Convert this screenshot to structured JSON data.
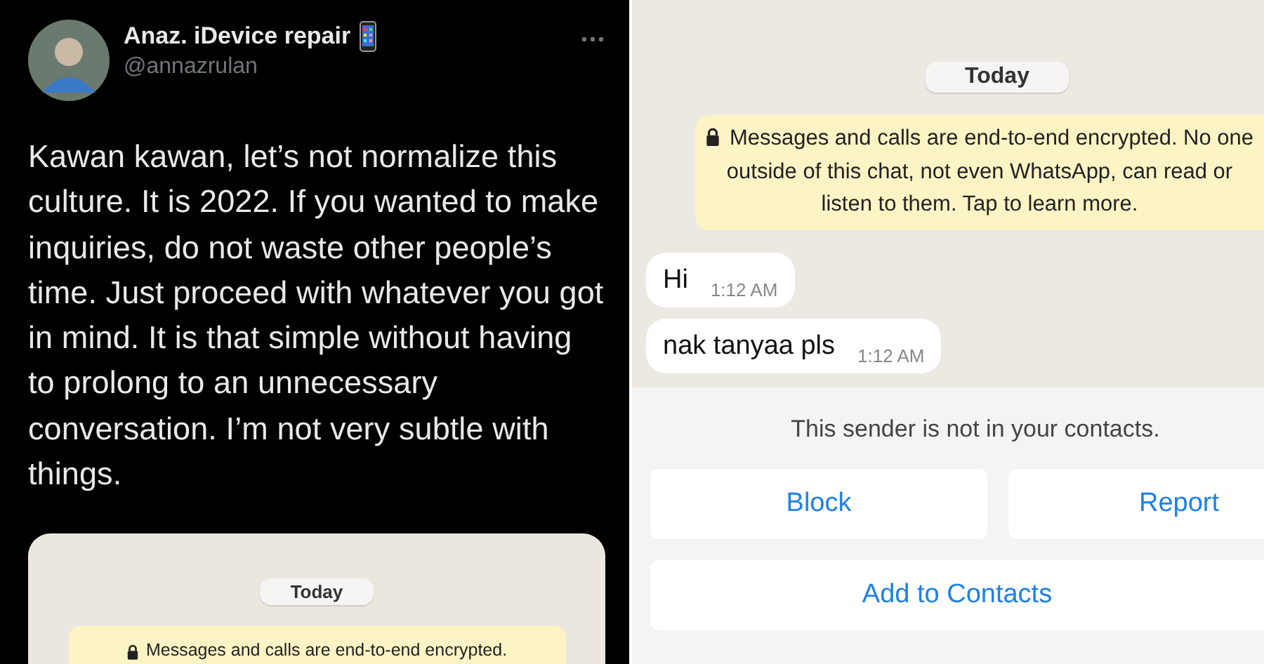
{
  "tweet": {
    "author_name": "Anaz. iDevice repair",
    "handle": "@annazrulan",
    "text": "Kawan kawan, let’s not normalize this culture. It is 2022. If you wanted to make inquiries, do not waste other people’s time. Just proceed with whatever you got in mind. It is that simple without having to prolong to an unnecessary conversation. I’m not very subtle with things.",
    "embedded_chat": {
      "date_chip": "Today",
      "encryption_notice": "Messages and calls are end-to-end encrypted."
    }
  },
  "chat": {
    "date_chip": "Today",
    "encryption_notice": "Messages and calls are end-to-end encrypted. No one outside of this chat, not even WhatsApp, can read or listen to them. Tap to learn more.",
    "messages": [
      {
        "text": "Hi",
        "time": "1:12 AM"
      },
      {
        "text": "nak tanyaa pls",
        "time": "1:12 AM"
      }
    ],
    "unknown_sender": {
      "notice": "This sender is not in your contacts.",
      "buttons": [
        {
          "label": "Block"
        },
        {
          "label": "Report"
        },
        {
          "label": "Add to Contacts"
        }
      ]
    }
  }
}
